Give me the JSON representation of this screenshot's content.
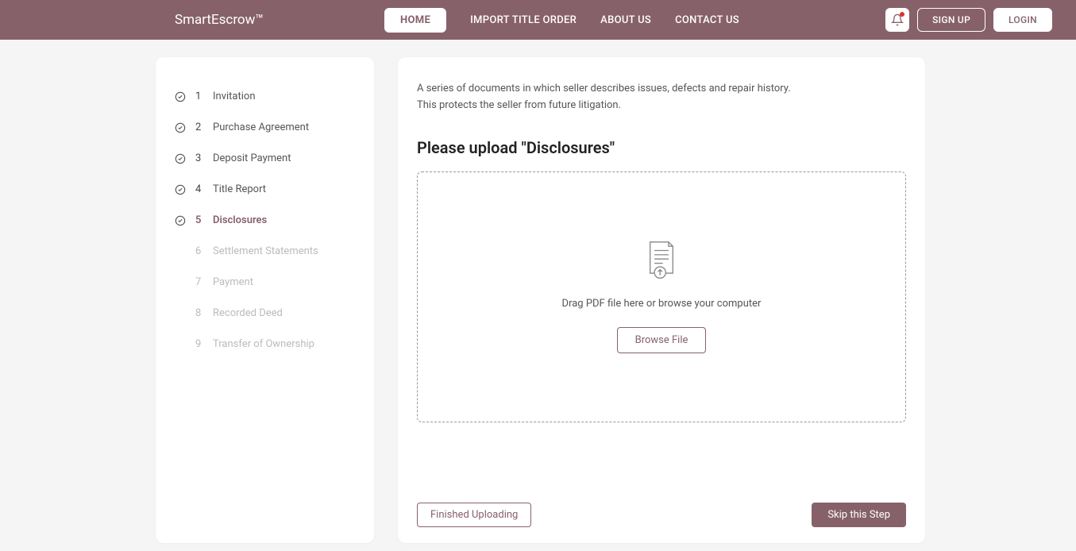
{
  "header": {
    "brand": "SmartEscrow™",
    "nav": {
      "home": "HOME",
      "import": "IMPORT TITLE ORDER",
      "about": "ABOUT US",
      "contact": "CONTACT US"
    },
    "signup": "SIGN UP",
    "login": "LOGIN"
  },
  "sidebar": {
    "steps": [
      {
        "num": "1",
        "label": "Invitation",
        "done": true
      },
      {
        "num": "2",
        "label": "Purchase Agreement",
        "done": true
      },
      {
        "num": "3",
        "label": "Deposit Payment",
        "done": true
      },
      {
        "num": "4",
        "label": "Title Report",
        "done": true
      },
      {
        "num": "5",
        "label": "Disclosures",
        "done": true,
        "current": true
      },
      {
        "num": "6",
        "label": "Settlement Statements",
        "done": false
      },
      {
        "num": "7",
        "label": "Payment",
        "done": false
      },
      {
        "num": "8",
        "label": "Recorded Deed",
        "done": false
      },
      {
        "num": "9",
        "label": "Transfer of Ownership",
        "done": false
      }
    ]
  },
  "content": {
    "description_line1": "A series of documents in which seller describes issues, defects and repair history.",
    "description_line2": "This protects the seller from future litigation.",
    "upload_title": "Please upload \"Disclosures\"",
    "drop_text": "Drag PDF file here or browse your computer",
    "browse_label": "Browse File",
    "finish_label": "Finished Uploading",
    "skip_label": "Skip this Step"
  }
}
